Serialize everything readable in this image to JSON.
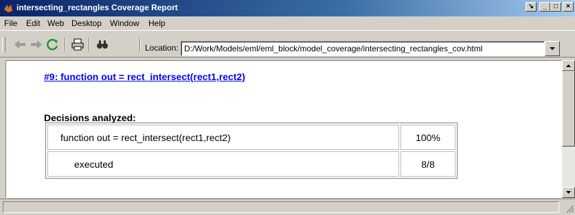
{
  "window": {
    "title": "intersecting_rectangles Coverage Report",
    "buttons": {
      "dock": "↘",
      "minimize": "_",
      "maximize": "□",
      "close": "×"
    }
  },
  "menu": {
    "items": [
      "File",
      "Edit",
      "Web",
      "Desktop",
      "Window",
      "Help"
    ]
  },
  "toolbar": {
    "icons": [
      "back-arrow-icon",
      "forward-arrow-icon",
      "refresh-icon",
      "print-icon",
      "find-icon"
    ],
    "location_label": "Location:",
    "location_value": "D:/Work/Models/eml/eml_block/model_coverage/intersecting_rectangles_cov.html"
  },
  "report": {
    "heading_link": "#9: function out = rect_intersect(rect1,rect2)",
    "section_title": "Decisions analyzed:",
    "rows": [
      {
        "label": "function out = rect_intersect(rect1,rect2)",
        "value": "100%"
      },
      {
        "label": "executed",
        "value": "8/8"
      }
    ]
  },
  "colors": {
    "titlebar_start": "#0a246a",
    "link": "#0000ff",
    "chrome": "#d4d0c8"
  }
}
